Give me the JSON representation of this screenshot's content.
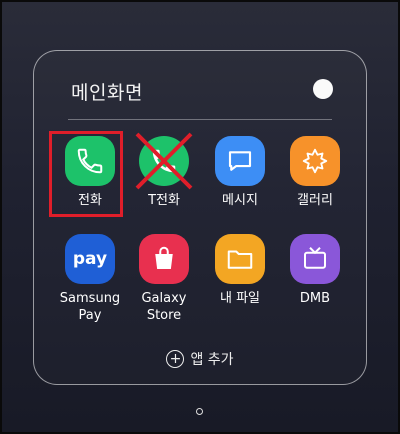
{
  "folder": {
    "title": "메인화면",
    "add_apps_label": "앱 추가"
  },
  "apps": [
    {
      "label": "전화",
      "icon": "phone-icon",
      "color": "#1dc26a"
    },
    {
      "label": "T전화",
      "icon": "t-phone-icon",
      "color": "#1dc26a"
    },
    {
      "label": "메시지",
      "icon": "messages-icon",
      "color": "#3d8ef5"
    },
    {
      "label": "갤러리",
      "icon": "gallery-icon",
      "color": "#f7922a"
    },
    {
      "label": "pay",
      "icon": "samsung-pay-icon",
      "color": "#1f5fd6"
    },
    {
      "label": "Samsung\nPay",
      "icon": "samsung-pay-icon",
      "color": "#1f5fd6"
    },
    {
      "label": "Galaxy\nStore",
      "icon": "galaxy-store-icon",
      "color": "#e8304f"
    },
    {
      "label": "내 파일",
      "icon": "my-files-icon",
      "color": "#f3a623"
    },
    {
      "label": "DMB",
      "icon": "dmb-icon",
      "color": "#8a57d9"
    }
  ],
  "colors": {
    "highlight": "#e01e2a",
    "cross": "#e01e2a"
  }
}
